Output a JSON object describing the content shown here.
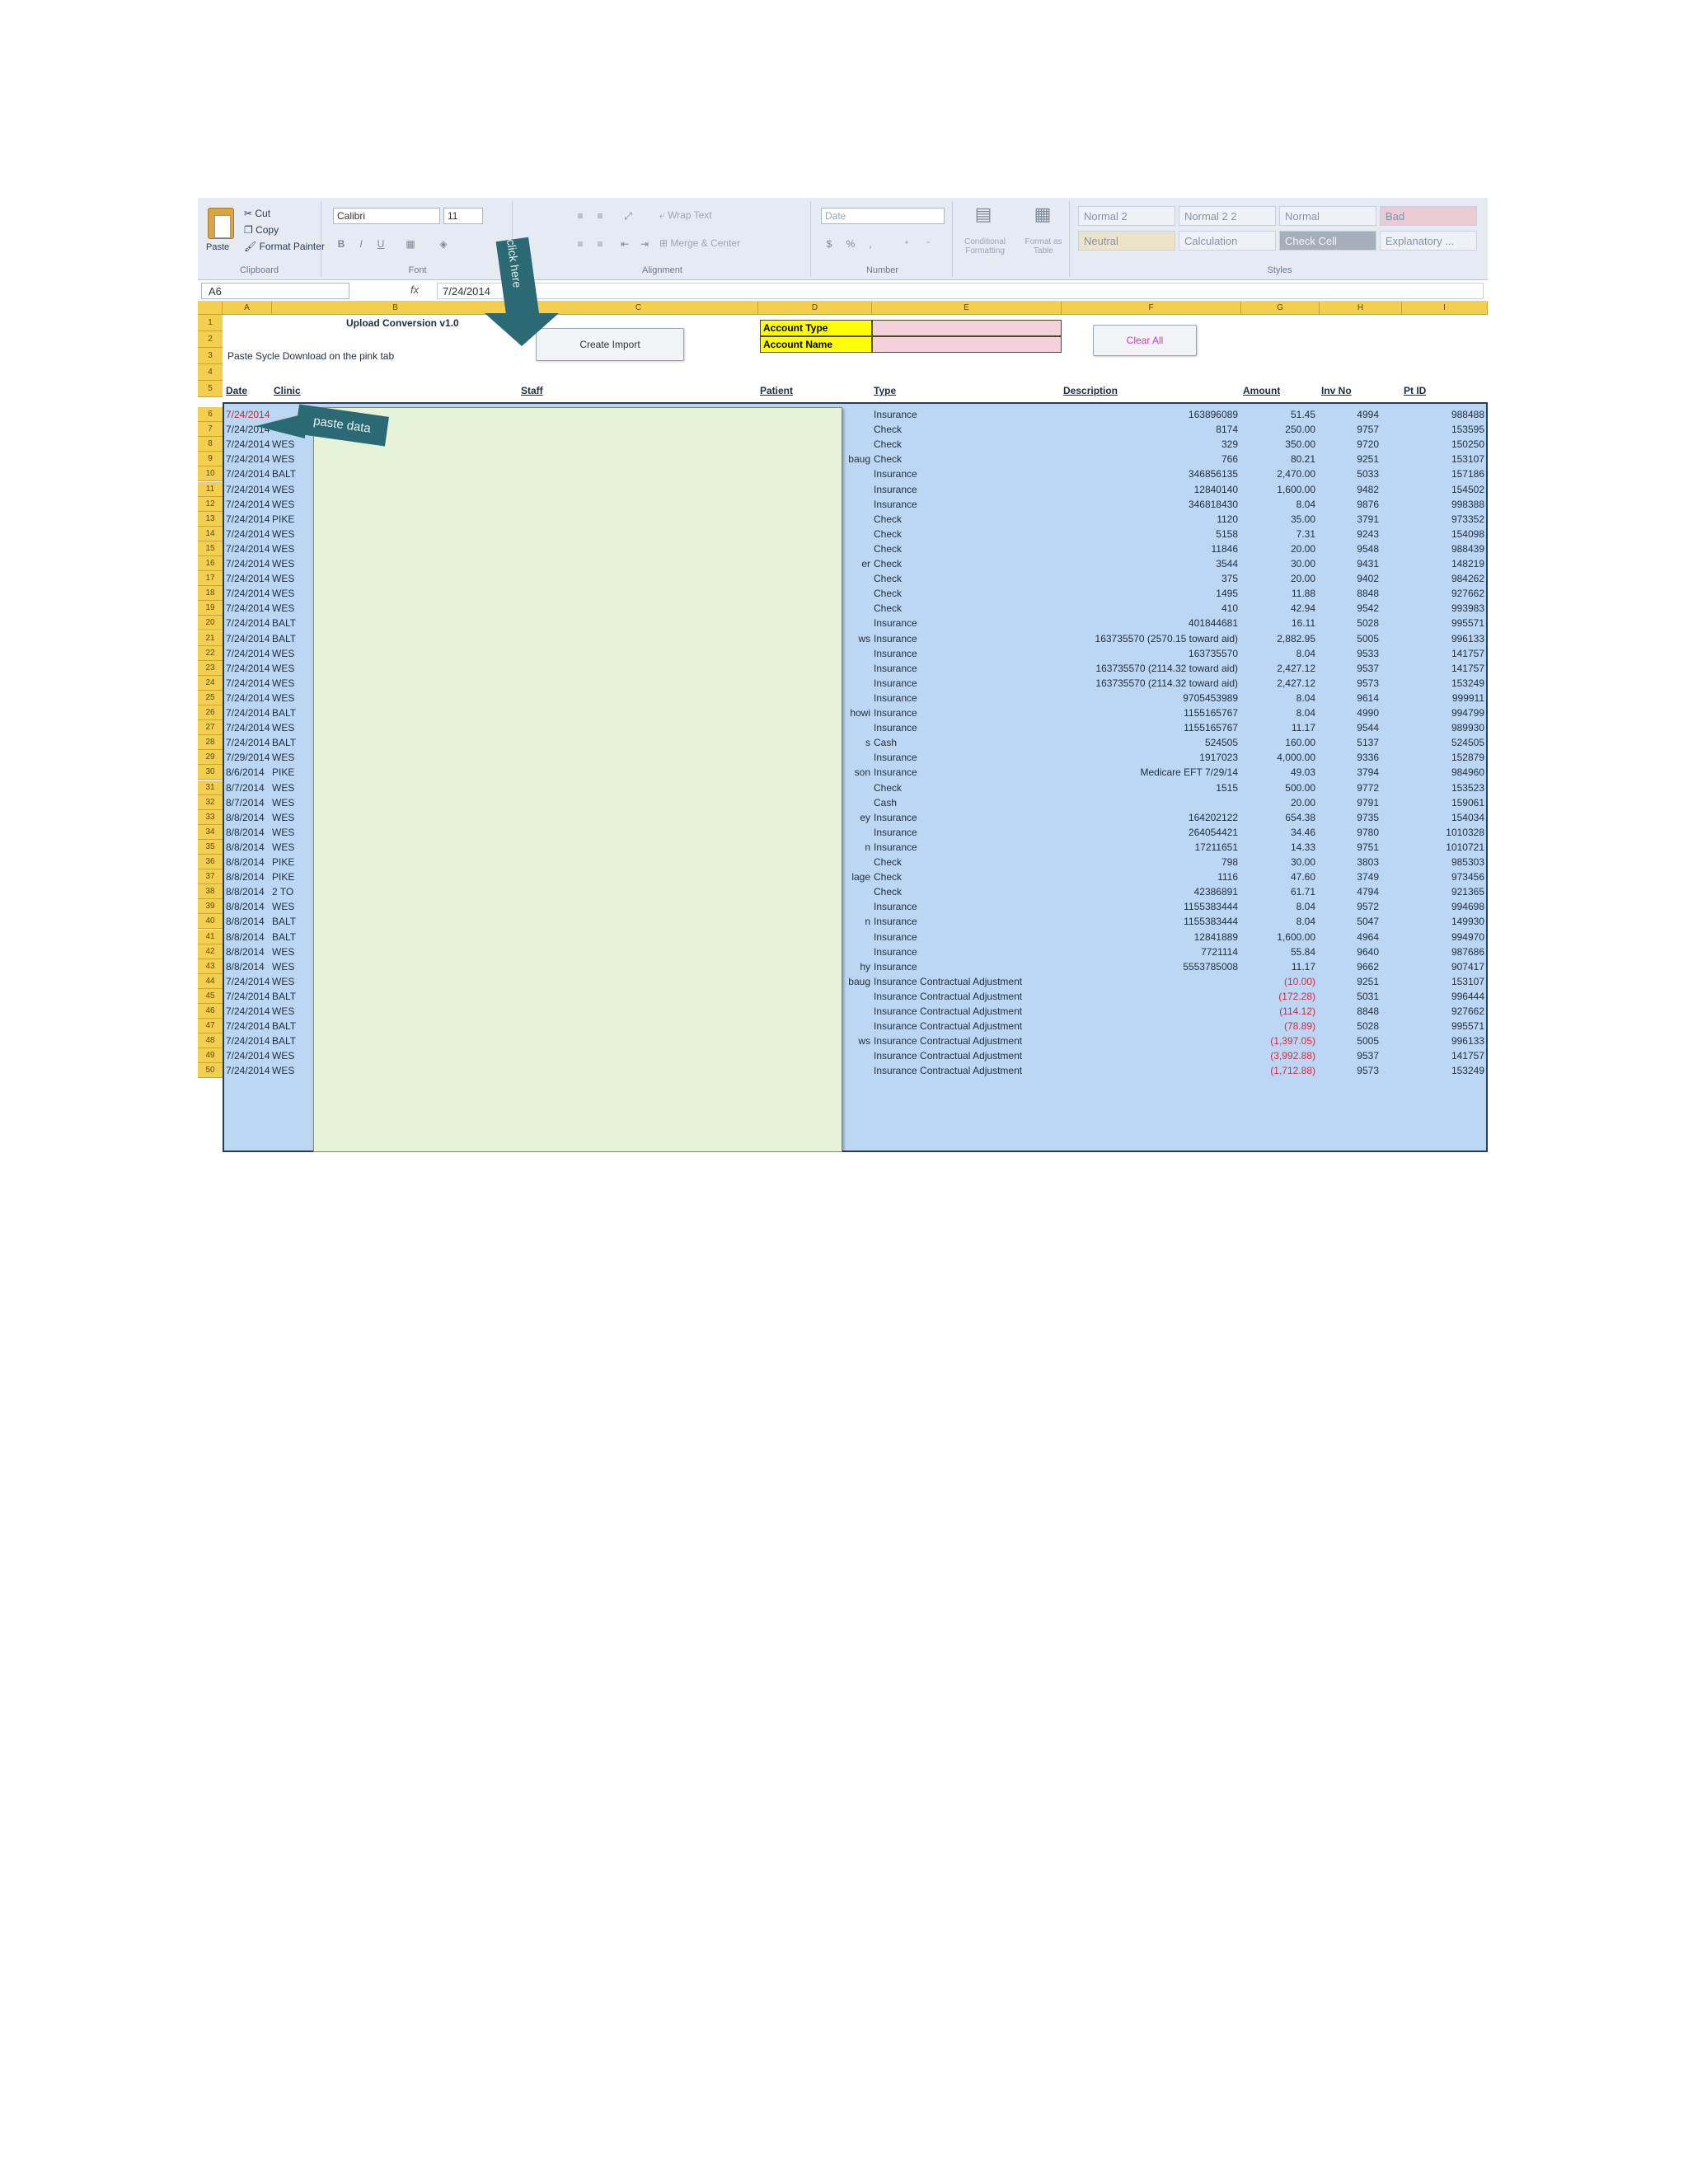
{
  "ribbon": {
    "clipboard": {
      "paste": "Paste",
      "cut": "Cut",
      "copy": "Copy",
      "format_painter": "Format Painter",
      "label": "Clipboard"
    },
    "font": {
      "name": "Calibri",
      "size": "11",
      "label": "Font"
    },
    "alignment": {
      "wrap_text": "Wrap Text",
      "merge_center": "Merge & Center",
      "label": "Alignment"
    },
    "number": {
      "format": "Date",
      "label": "Number"
    },
    "conditional_formatting": "Conditional Formatting",
    "format_as_table": "Format as Table",
    "styles": {
      "items": [
        "Normal 2",
        "Normal 2 2",
        "Normal",
        "Bad",
        "Neutral",
        "Calculation",
        "Check Cell",
        "Explanatory ..."
      ],
      "label": "Styles"
    }
  },
  "formula_bar": {
    "name_box": "A6",
    "fx": "fx",
    "value": "7/24/2014"
  },
  "columns": [
    "A",
    "B",
    "C",
    "D",
    "E",
    "F",
    "G",
    "H",
    "I"
  ],
  "sheet": {
    "title": "Upload Conversion v1.0",
    "instruction": "Paste Sycle Download on the pink tab",
    "create_import": "Create Import",
    "clear_all": "Clear All",
    "account_type_label": "Account Type",
    "account_name_label": "Account Name",
    "account_type_value": "",
    "account_name_value": ""
  },
  "headers": {
    "date": "Date",
    "clinic": "Clinic",
    "staff": "Staff",
    "patient": "Patient",
    "type": "Type",
    "description": "Description",
    "amount": "Amount",
    "inv_no": "Inv No",
    "pt_id": "Pt ID"
  },
  "callouts": {
    "click_here": "click here",
    "paste_data": "paste data"
  },
  "rows": [
    {
      "n": "6",
      "date": "7/24/2014",
      "clinic": "",
      "patient": "",
      "type": "Insurance",
      "desc": "163896089",
      "amount": "51.45",
      "inv": "4994",
      "pt": "988488"
    },
    {
      "n": "7",
      "date": "7/24/2014",
      "clinic": "",
      "patient": "",
      "type": "Check",
      "desc": "8174",
      "amount": "250.00",
      "inv": "9757",
      "pt": "153595"
    },
    {
      "n": "8",
      "date": "7/24/2014",
      "clinic": "WES",
      "patient": "",
      "type": "Check",
      "desc": "329",
      "amount": "350.00",
      "inv": "9720",
      "pt": "150250"
    },
    {
      "n": "9",
      "date": "7/24/2014",
      "clinic": "WES",
      "patient": "baug",
      "type": "Check",
      "desc": "766",
      "amount": "80.21",
      "inv": "9251",
      "pt": "153107"
    },
    {
      "n": "10",
      "date": "7/24/2014",
      "clinic": "BALT",
      "patient": "",
      "type": "Insurance",
      "desc": "346856135",
      "amount": "2,470.00",
      "inv": "5033",
      "pt": "157186"
    },
    {
      "n": "11",
      "date": "7/24/2014",
      "clinic": "WES",
      "patient": "",
      "type": "Insurance",
      "desc": "12840140",
      "amount": "1,600.00",
      "inv": "9482",
      "pt": "154502"
    },
    {
      "n": "12",
      "date": "7/24/2014",
      "clinic": "WES",
      "patient": "",
      "type": "Insurance",
      "desc": "346818430",
      "amount": "8.04",
      "inv": "9876",
      "pt": "998388"
    },
    {
      "n": "13",
      "date": "7/24/2014",
      "clinic": "PIKE",
      "patient": "",
      "type": "Check",
      "desc": "1120",
      "amount": "35.00",
      "inv": "3791",
      "pt": "973352"
    },
    {
      "n": "14",
      "date": "7/24/2014",
      "clinic": "WES",
      "patient": "",
      "type": "Check",
      "desc": "5158",
      "amount": "7.31",
      "inv": "9243",
      "pt": "154098"
    },
    {
      "n": "15",
      "date": "7/24/2014",
      "clinic": "WES",
      "patient": "",
      "type": "Check",
      "desc": "11846",
      "amount": "20.00",
      "inv": "9548",
      "pt": "988439"
    },
    {
      "n": "16",
      "date": "7/24/2014",
      "clinic": "WES",
      "patient": "er",
      "type": "Check",
      "desc": "3544",
      "amount": "30.00",
      "inv": "9431",
      "pt": "148219"
    },
    {
      "n": "17",
      "date": "7/24/2014",
      "clinic": "WES",
      "patient": "",
      "type": "Check",
      "desc": "375",
      "amount": "20.00",
      "inv": "9402",
      "pt": "984262"
    },
    {
      "n": "18",
      "date": "7/24/2014",
      "clinic": "WES",
      "patient": "",
      "type": "Check",
      "desc": "1495",
      "amount": "11.88",
      "inv": "8848",
      "pt": "927662"
    },
    {
      "n": "19",
      "date": "7/24/2014",
      "clinic": "WES",
      "patient": "",
      "type": "Check",
      "desc": "410",
      "amount": "42.94",
      "inv": "9542",
      "pt": "993983"
    },
    {
      "n": "20",
      "date": "7/24/2014",
      "clinic": "BALT",
      "patient": "",
      "type": "Insurance",
      "desc": "401844681",
      "amount": "16.11",
      "inv": "5028",
      "pt": "995571"
    },
    {
      "n": "21",
      "date": "7/24/2014",
      "clinic": "BALT",
      "patient": "ws",
      "type": "Insurance",
      "desc": "163735570 (2570.15 toward aid)",
      "amount": "2,882.95",
      "inv": "5005",
      "pt": "996133"
    },
    {
      "n": "22",
      "date": "7/24/2014",
      "clinic": "WES",
      "patient": "",
      "type": "Insurance",
      "desc": "163735570",
      "amount": "8.04",
      "inv": "9533",
      "pt": "141757"
    },
    {
      "n": "23",
      "date": "7/24/2014",
      "clinic": "WES",
      "patient": "",
      "type": "Insurance",
      "desc": "163735570 (2114.32 toward aid)",
      "amount": "2,427.12",
      "inv": "9537",
      "pt": "141757"
    },
    {
      "n": "24",
      "date": "7/24/2014",
      "clinic": "WES",
      "patient": "",
      "type": "Insurance",
      "desc": "163735570 (2114.32 toward aid)",
      "amount": "2,427.12",
      "inv": "9573",
      "pt": "153249"
    },
    {
      "n": "25",
      "date": "7/24/2014",
      "clinic": "WES",
      "patient": "",
      "type": "Insurance",
      "desc": "9705453989",
      "amount": "8.04",
      "inv": "9614",
      "pt": "999911"
    },
    {
      "n": "26",
      "date": "7/24/2014",
      "clinic": "BALT",
      "patient": "howi",
      "type": "Insurance",
      "desc": "1155165767",
      "amount": "8.04",
      "inv": "4990",
      "pt": "994799"
    },
    {
      "n": "27",
      "date": "7/24/2014",
      "clinic": "WES",
      "patient": "",
      "type": "Insurance",
      "desc": "1155165767",
      "amount": "11.17",
      "inv": "9544",
      "pt": "989930"
    },
    {
      "n": "28",
      "date": "7/24/2014",
      "clinic": "BALT",
      "patient": "s",
      "type": "Cash",
      "desc": "524505",
      "amount": "160.00",
      "inv": "5137",
      "pt": "524505"
    },
    {
      "n": "29",
      "date": "7/29/2014",
      "clinic": "WES",
      "patient": "",
      "type": "Insurance",
      "desc": "1917023",
      "amount": "4,000.00",
      "inv": "9336",
      "pt": "152879"
    },
    {
      "n": "30",
      "date": "8/6/2014",
      "clinic": "PIKE",
      "patient": "son",
      "type": "Insurance",
      "desc": "Medicare EFT 7/29/14",
      "amount": "49.03",
      "inv": "3794",
      "pt": "984960"
    },
    {
      "n": "31",
      "date": "8/7/2014",
      "clinic": "WES",
      "patient": "",
      "type": "Check",
      "desc": "1515",
      "amount": "500.00",
      "inv": "9772",
      "pt": "153523"
    },
    {
      "n": "32",
      "date": "8/7/2014",
      "clinic": "WES",
      "patient": "",
      "type": "Cash",
      "desc": "",
      "amount": "20.00",
      "inv": "9791",
      "pt": "159061"
    },
    {
      "n": "33",
      "date": "8/8/2014",
      "clinic": "WES",
      "patient": "ey",
      "type": "Insurance",
      "desc": "164202122",
      "amount": "654.38",
      "inv": "9735",
      "pt": "154034"
    },
    {
      "n": "34",
      "date": "8/8/2014",
      "clinic": "WES",
      "patient": "",
      "type": "Insurance",
      "desc": "264054421",
      "amount": "34.46",
      "inv": "9780",
      "pt": "1010328"
    },
    {
      "n": "35",
      "date": "8/8/2014",
      "clinic": "WES",
      "patient": "n",
      "type": "Insurance",
      "desc": "17211651",
      "amount": "14.33",
      "inv": "9751",
      "pt": "1010721"
    },
    {
      "n": "36",
      "date": "8/8/2014",
      "clinic": "PIKE",
      "patient": "",
      "type": "Check",
      "desc": "798",
      "amount": "30.00",
      "inv": "3803",
      "pt": "985303"
    },
    {
      "n": "37",
      "date": "8/8/2014",
      "clinic": "PIKE",
      "patient": "lage",
      "type": "Check",
      "desc": "1116",
      "amount": "47.60",
      "inv": "3749",
      "pt": "973456"
    },
    {
      "n": "38",
      "date": "8/8/2014",
      "clinic": "2 TO",
      "patient": "",
      "type": "Check",
      "desc": "42386891",
      "amount": "61.71",
      "inv": "4794",
      "pt": "921365"
    },
    {
      "n": "39",
      "date": "8/8/2014",
      "clinic": "WES",
      "patient": "",
      "type": "Insurance",
      "desc": "1155383444",
      "amount": "8.04",
      "inv": "9572",
      "pt": "994698"
    },
    {
      "n": "40",
      "date": "8/8/2014",
      "clinic": "BALT",
      "patient": "n",
      "type": "Insurance",
      "desc": "1155383444",
      "amount": "8.04",
      "inv": "5047",
      "pt": "149930"
    },
    {
      "n": "41",
      "date": "8/8/2014",
      "clinic": "BALT",
      "patient": "",
      "type": "Insurance",
      "desc": "12841889",
      "amount": "1,600.00",
      "inv": "4964",
      "pt": "994970"
    },
    {
      "n": "42",
      "date": "8/8/2014",
      "clinic": "WES",
      "patient": "",
      "type": "Insurance",
      "desc": "7721114",
      "amount": "55.84",
      "inv": "9640",
      "pt": "987686"
    },
    {
      "n": "43",
      "date": "8/8/2014",
      "clinic": "WES",
      "patient": "hy",
      "type": "Insurance",
      "desc": "5553785008",
      "amount": "11.17",
      "inv": "9662",
      "pt": "907417"
    },
    {
      "n": "44",
      "date": "7/24/2014",
      "clinic": "WES",
      "patient": "baug",
      "type": "Insurance Contractual Adjustment",
      "desc": "",
      "amount": "(10.00)",
      "inv": "9251",
      "pt": "153107",
      "neg": true
    },
    {
      "n": "45",
      "date": "7/24/2014",
      "clinic": "BALT",
      "patient": "",
      "type": "Insurance Contractual Adjustment",
      "desc": "",
      "amount": "(172.28)",
      "inv": "5031",
      "pt": "996444",
      "neg": true
    },
    {
      "n": "46",
      "date": "7/24/2014",
      "clinic": "WES",
      "patient": "",
      "type": "Insurance Contractual Adjustment",
      "desc": "",
      "amount": "(114.12)",
      "inv": "8848",
      "pt": "927662",
      "neg": true
    },
    {
      "n": "47",
      "date": "7/24/2014",
      "clinic": "BALT",
      "patient": "",
      "type": "Insurance Contractual Adjustment",
      "desc": "",
      "amount": "(78.89)",
      "inv": "5028",
      "pt": "995571",
      "neg": true
    },
    {
      "n": "48",
      "date": "7/24/2014",
      "clinic": "BALT",
      "patient": "ws",
      "type": "Insurance Contractual Adjustment",
      "desc": "",
      "amount": "(1,397.05)",
      "inv": "5005",
      "pt": "996133",
      "neg": true
    },
    {
      "n": "49",
      "date": "7/24/2014",
      "clinic": "WES",
      "patient": "",
      "type": "Insurance Contractual Adjustment",
      "desc": "",
      "amount": "(3,992.88)",
      "inv": "9537",
      "pt": "141757",
      "neg": true
    },
    {
      "n": "50",
      "date": "7/24/2014",
      "clinic": "WES",
      "patient": "",
      "type": "Insurance Contractual Adjustment",
      "desc": "",
      "amount": "(1,712.88)",
      "inv": "9573",
      "pt": "153249",
      "neg": true
    }
  ]
}
